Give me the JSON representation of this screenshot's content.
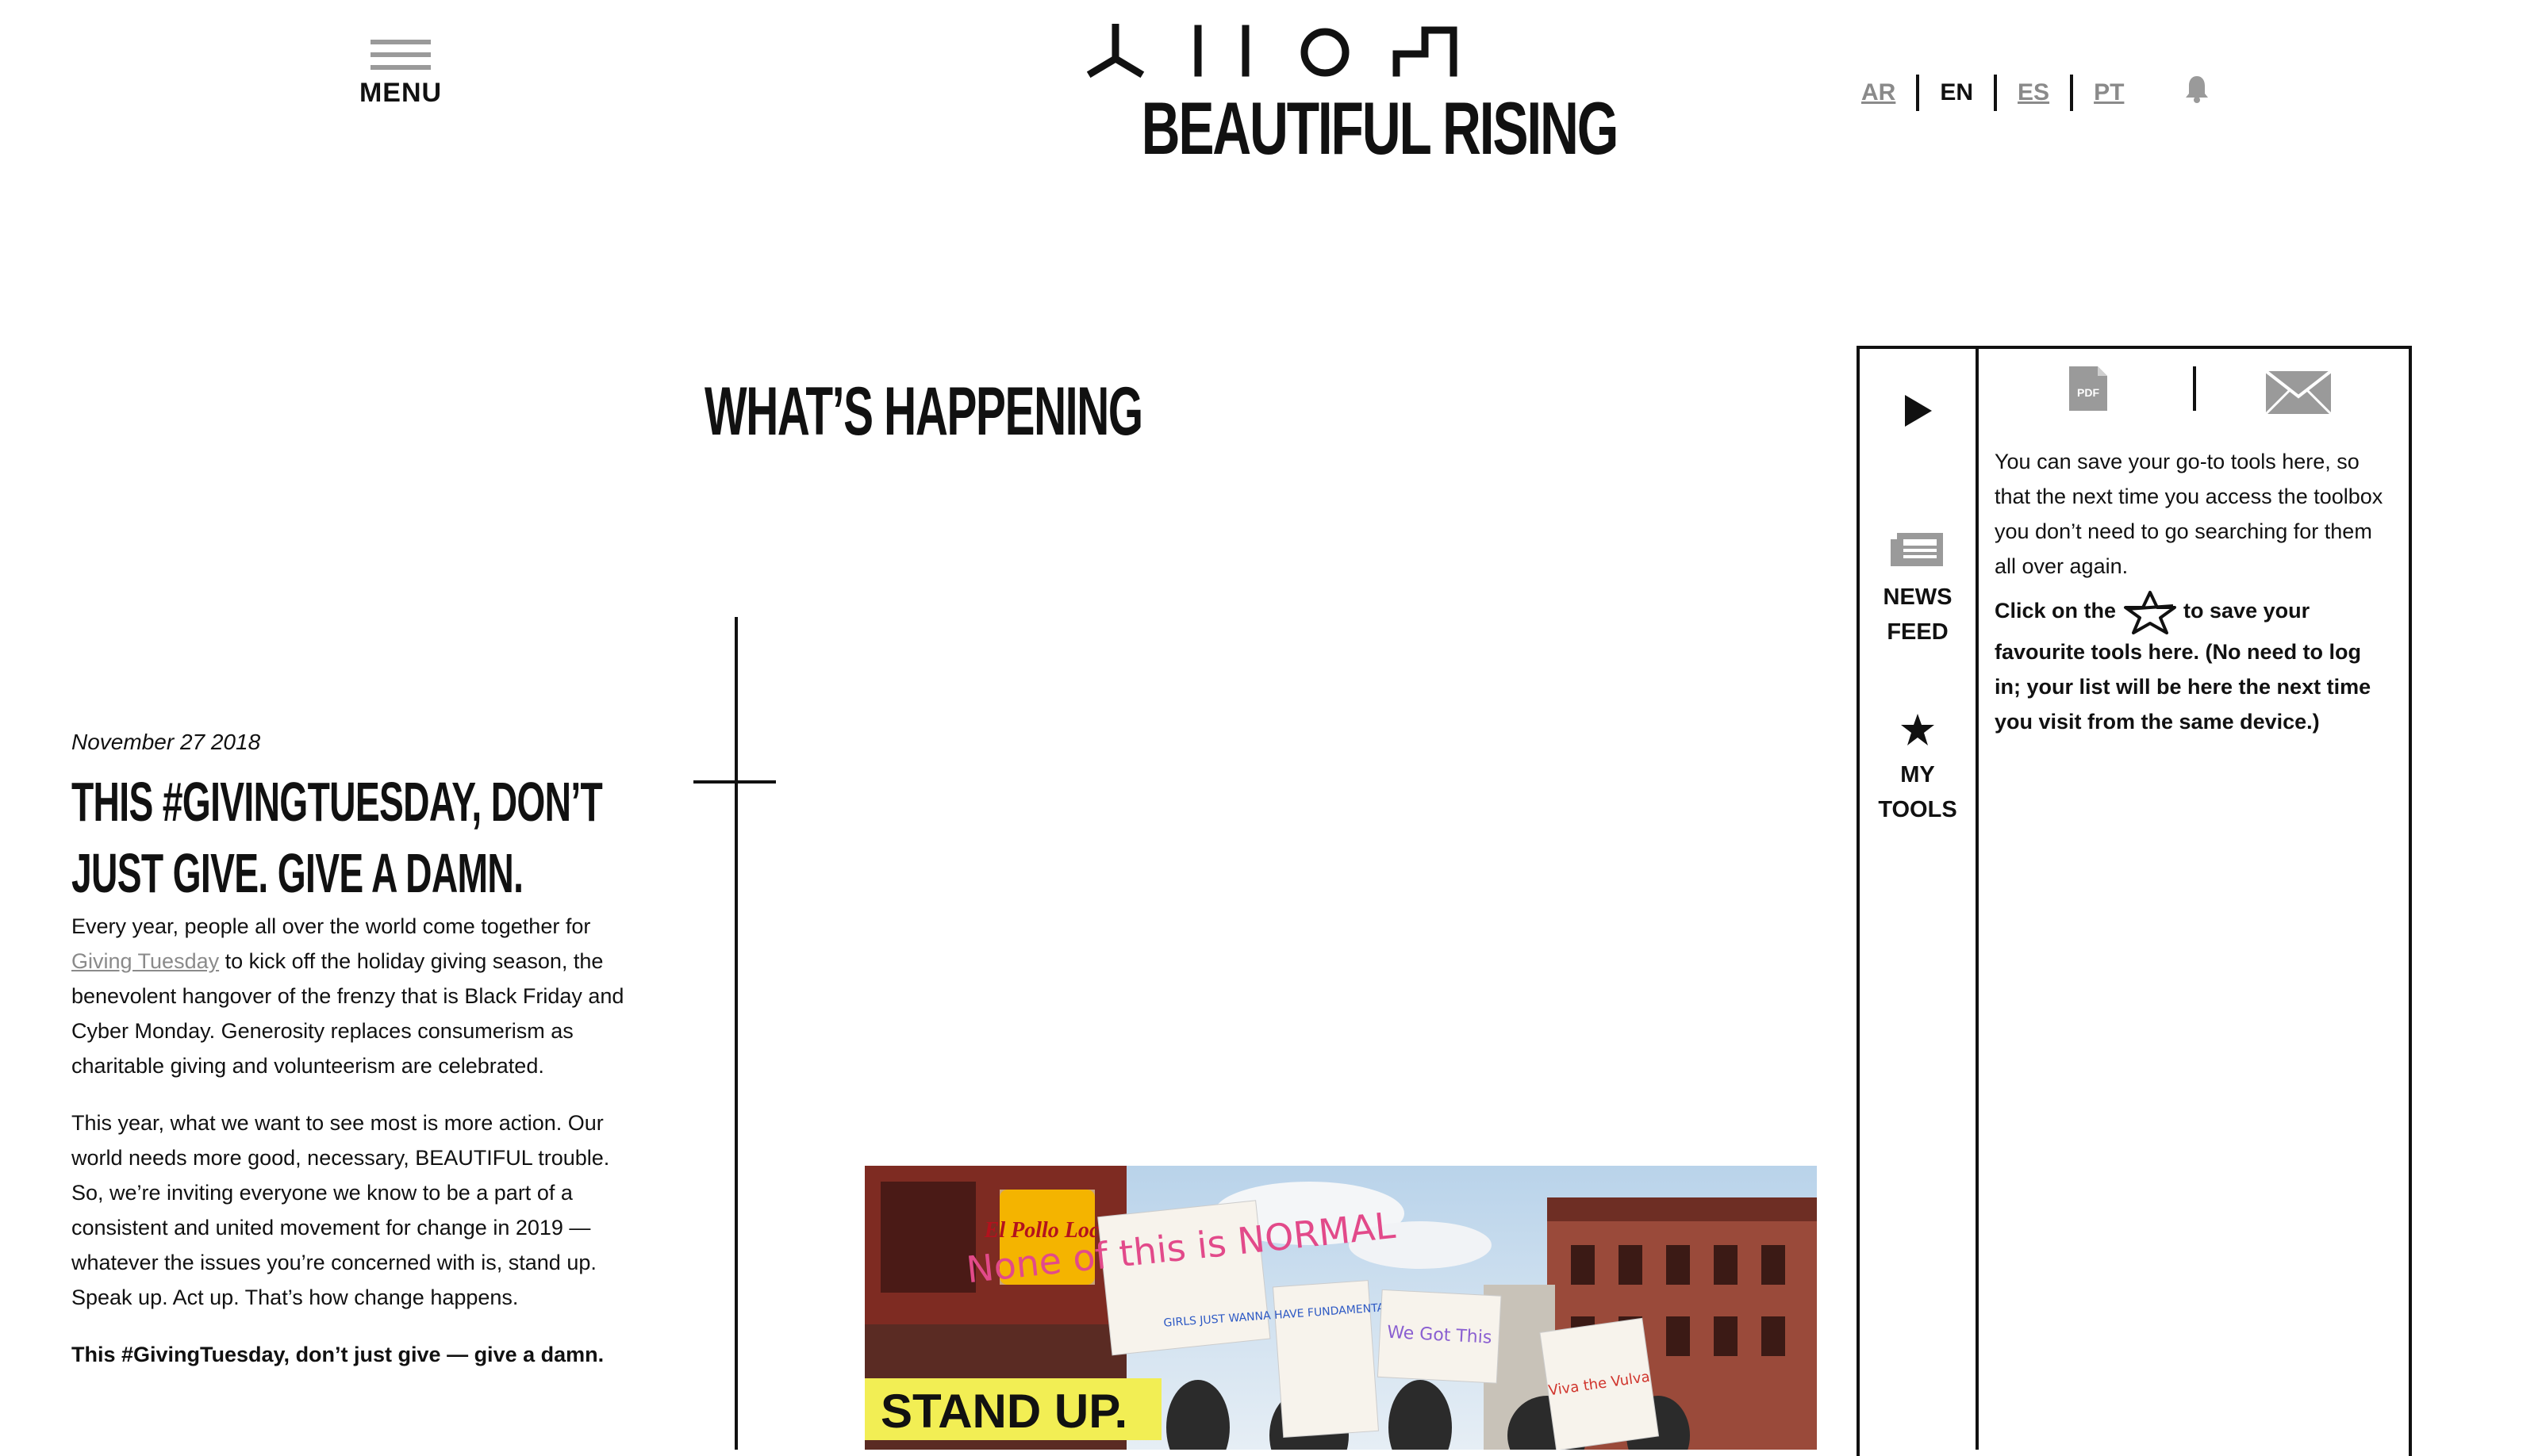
{
  "header": {
    "menu_label": "MENU",
    "logo_text": "BEAUTIFUL RISING",
    "languages": [
      "AR",
      "EN",
      "ES",
      "PT"
    ],
    "active_language": "EN"
  },
  "page": {
    "title": "WHAT’S HAPPENING"
  },
  "article": {
    "date": "November 27 2018",
    "title": "THIS #GIVINGTUESDAY, DON’T JUST GIVE. GIVE A DAMN.",
    "p1_before": "Every year, people all over the world come together for ",
    "p1_link": "Giving Tuesday",
    "p1_after": " to kick off the holiday giving season, the benevolent hangover of the frenzy that is Black Friday and Cyber Monday. Generosity replaces consumerism as charitable giving and volunteerism are celebrated.",
    "p2": "This year, what we want to see most is more action. Our world needs more good, necessary, BEAUTIFUL trouble. So, we’re inviting everyone we know to be a part of a consistent and united movement for change in 2019 — whatever the issues you’re concerned with is, stand up. Speak up. Act up. That’s how change happens.",
    "p3": "This #GivingTuesday, don’t just give — give a damn."
  },
  "hero_image": {
    "overlay_text": "STAND UP.",
    "signs": [
      "None of this is NORMAL",
      "GIRLS JUST WANNA HAVE FUNDAMENTAL HUMAN RIGHTS",
      "We Got This",
      "Viva the Vulva",
      "El Pollo Loco"
    ]
  },
  "side_panel": {
    "news_label_1": "NEWS",
    "news_label_2": "FEED",
    "tools_label_1": "MY",
    "tools_label_2": "TOOLS",
    "pdf_label": "PDF",
    "intro": "You can save your go-to tools here, so that the next time you access the toolbox you don’t need to go searching for them all over again.",
    "cta_before": "Click on the ",
    "cta_after": " to save your favourite tools here. (No need to log in; your list will be here the next time you visit from the same device.)"
  },
  "colors": {
    "text": "#111111",
    "muted": "#8a8a8a",
    "highlight": "#f2ee54",
    "background": "#ffffff"
  }
}
